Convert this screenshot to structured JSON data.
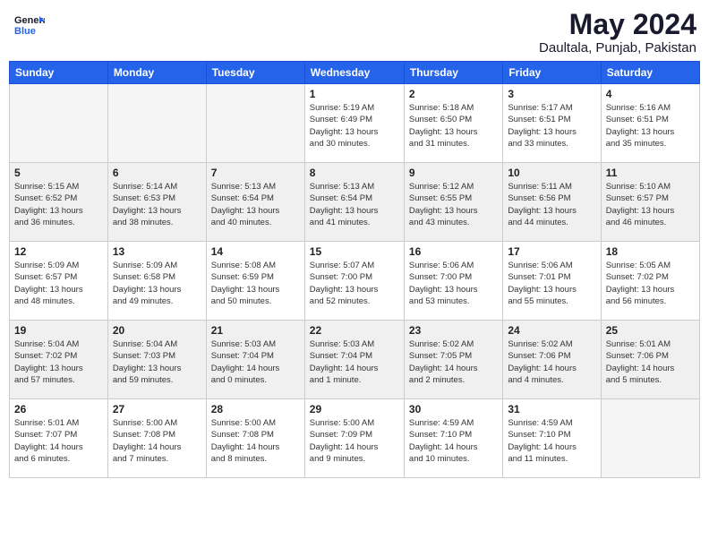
{
  "header": {
    "logo_line1": "General",
    "logo_line2": "Blue",
    "month": "May 2024",
    "location": "Daultala, Punjab, Pakistan"
  },
  "days_of_week": [
    "Sunday",
    "Monday",
    "Tuesday",
    "Wednesday",
    "Thursday",
    "Friday",
    "Saturday"
  ],
  "weeks": [
    [
      {
        "day": "",
        "info": ""
      },
      {
        "day": "",
        "info": ""
      },
      {
        "day": "",
        "info": ""
      },
      {
        "day": "1",
        "info": "Sunrise: 5:19 AM\nSunset: 6:49 PM\nDaylight: 13 hours\nand 30 minutes."
      },
      {
        "day": "2",
        "info": "Sunrise: 5:18 AM\nSunset: 6:50 PM\nDaylight: 13 hours\nand 31 minutes."
      },
      {
        "day": "3",
        "info": "Sunrise: 5:17 AM\nSunset: 6:51 PM\nDaylight: 13 hours\nand 33 minutes."
      },
      {
        "day": "4",
        "info": "Sunrise: 5:16 AM\nSunset: 6:51 PM\nDaylight: 13 hours\nand 35 minutes."
      }
    ],
    [
      {
        "day": "5",
        "info": "Sunrise: 5:15 AM\nSunset: 6:52 PM\nDaylight: 13 hours\nand 36 minutes."
      },
      {
        "day": "6",
        "info": "Sunrise: 5:14 AM\nSunset: 6:53 PM\nDaylight: 13 hours\nand 38 minutes."
      },
      {
        "day": "7",
        "info": "Sunrise: 5:13 AM\nSunset: 6:54 PM\nDaylight: 13 hours\nand 40 minutes."
      },
      {
        "day": "8",
        "info": "Sunrise: 5:13 AM\nSunset: 6:54 PM\nDaylight: 13 hours\nand 41 minutes."
      },
      {
        "day": "9",
        "info": "Sunrise: 5:12 AM\nSunset: 6:55 PM\nDaylight: 13 hours\nand 43 minutes."
      },
      {
        "day": "10",
        "info": "Sunrise: 5:11 AM\nSunset: 6:56 PM\nDaylight: 13 hours\nand 44 minutes."
      },
      {
        "day": "11",
        "info": "Sunrise: 5:10 AM\nSunset: 6:57 PM\nDaylight: 13 hours\nand 46 minutes."
      }
    ],
    [
      {
        "day": "12",
        "info": "Sunrise: 5:09 AM\nSunset: 6:57 PM\nDaylight: 13 hours\nand 48 minutes."
      },
      {
        "day": "13",
        "info": "Sunrise: 5:09 AM\nSunset: 6:58 PM\nDaylight: 13 hours\nand 49 minutes."
      },
      {
        "day": "14",
        "info": "Sunrise: 5:08 AM\nSunset: 6:59 PM\nDaylight: 13 hours\nand 50 minutes."
      },
      {
        "day": "15",
        "info": "Sunrise: 5:07 AM\nSunset: 7:00 PM\nDaylight: 13 hours\nand 52 minutes."
      },
      {
        "day": "16",
        "info": "Sunrise: 5:06 AM\nSunset: 7:00 PM\nDaylight: 13 hours\nand 53 minutes."
      },
      {
        "day": "17",
        "info": "Sunrise: 5:06 AM\nSunset: 7:01 PM\nDaylight: 13 hours\nand 55 minutes."
      },
      {
        "day": "18",
        "info": "Sunrise: 5:05 AM\nSunset: 7:02 PM\nDaylight: 13 hours\nand 56 minutes."
      }
    ],
    [
      {
        "day": "19",
        "info": "Sunrise: 5:04 AM\nSunset: 7:02 PM\nDaylight: 13 hours\nand 57 minutes."
      },
      {
        "day": "20",
        "info": "Sunrise: 5:04 AM\nSunset: 7:03 PM\nDaylight: 13 hours\nand 59 minutes."
      },
      {
        "day": "21",
        "info": "Sunrise: 5:03 AM\nSunset: 7:04 PM\nDaylight: 14 hours\nand 0 minutes."
      },
      {
        "day": "22",
        "info": "Sunrise: 5:03 AM\nSunset: 7:04 PM\nDaylight: 14 hours\nand 1 minute."
      },
      {
        "day": "23",
        "info": "Sunrise: 5:02 AM\nSunset: 7:05 PM\nDaylight: 14 hours\nand 2 minutes."
      },
      {
        "day": "24",
        "info": "Sunrise: 5:02 AM\nSunset: 7:06 PM\nDaylight: 14 hours\nand 4 minutes."
      },
      {
        "day": "25",
        "info": "Sunrise: 5:01 AM\nSunset: 7:06 PM\nDaylight: 14 hours\nand 5 minutes."
      }
    ],
    [
      {
        "day": "26",
        "info": "Sunrise: 5:01 AM\nSunset: 7:07 PM\nDaylight: 14 hours\nand 6 minutes."
      },
      {
        "day": "27",
        "info": "Sunrise: 5:00 AM\nSunset: 7:08 PM\nDaylight: 14 hours\nand 7 minutes."
      },
      {
        "day": "28",
        "info": "Sunrise: 5:00 AM\nSunset: 7:08 PM\nDaylight: 14 hours\nand 8 minutes."
      },
      {
        "day": "29",
        "info": "Sunrise: 5:00 AM\nSunset: 7:09 PM\nDaylight: 14 hours\nand 9 minutes."
      },
      {
        "day": "30",
        "info": "Sunrise: 4:59 AM\nSunset: 7:10 PM\nDaylight: 14 hours\nand 10 minutes."
      },
      {
        "day": "31",
        "info": "Sunrise: 4:59 AM\nSunset: 7:10 PM\nDaylight: 14 hours\nand 11 minutes."
      },
      {
        "day": "",
        "info": ""
      }
    ]
  ]
}
